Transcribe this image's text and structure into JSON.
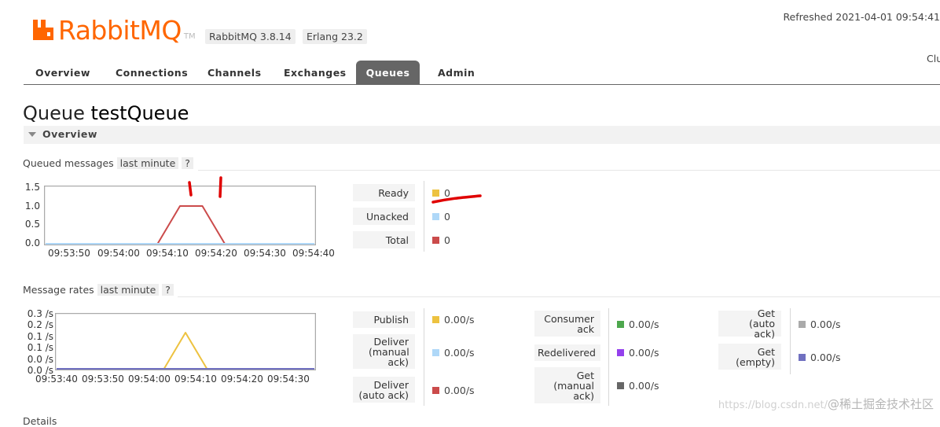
{
  "header": {
    "logo_text": "RabbitMQ",
    "logo_tm": "TM",
    "version_badge": "RabbitMQ 3.8.14",
    "erlang_badge": "Erlang 23.2",
    "refreshed": "Refreshed 2021-04-01 09:54:41",
    "cluster_partial": "Clu",
    "brand_color": "#ff6600"
  },
  "nav": {
    "tabs": [
      {
        "label": "Overview"
      },
      {
        "label": "Connections"
      },
      {
        "label": "Channels"
      },
      {
        "label": "Exchanges"
      },
      {
        "label": "Queues",
        "active": true
      },
      {
        "label": "Admin"
      }
    ]
  },
  "page": {
    "title_prefix": "Queue",
    "queue_name": "testQueue",
    "section_label": "Overview",
    "details_label": "Details"
  },
  "queued_messages": {
    "heading": "Queued messages",
    "range_chip": "last minute",
    "help_chip": "?",
    "stats": [
      {
        "label": "Ready",
        "value": "0",
        "color": "#edc240"
      },
      {
        "label": "Unacked",
        "value": "0",
        "color": "#afd8f8"
      },
      {
        "label": "Total",
        "value": "0",
        "color": "#cb4b4b"
      }
    ]
  },
  "message_rates": {
    "heading": "Message rates",
    "range_chip": "last minute",
    "help_chip": "?",
    "stats_col1": [
      {
        "label": "Publish",
        "value": "0.00/s",
        "color": "#edc240"
      },
      {
        "label": "Deliver (manual ack)",
        "value": "0.00/s",
        "color": "#afd8f8"
      },
      {
        "label": "Deliver (auto ack)",
        "value": "0.00/s",
        "color": "#cb4b4b"
      }
    ],
    "stats_col2": [
      {
        "label": "Consumer ack",
        "value": "0.00/s",
        "color": "#4da74d"
      },
      {
        "label": "Redelivered",
        "value": "0.00/s",
        "color": "#9440ed"
      },
      {
        "label": "Get (manual ack)",
        "value": "0.00/s",
        "color": "#666666"
      }
    ],
    "stats_col3": [
      {
        "label": "Get (auto ack)",
        "value": "0.00/s",
        "color": "#aaaaaa"
      },
      {
        "label": "Get (empty)",
        "value": "0.00/s",
        "color": "#7070c0"
      }
    ]
  },
  "chart_data": [
    {
      "type": "line",
      "ylim": [
        0,
        1.5
      ],
      "yticks": [
        "1.5",
        "1.0",
        "0.5",
        "0.0"
      ],
      "xlim": [
        "09:53:48",
        "09:54:48"
      ],
      "xticks": [
        "09:53:50",
        "09:54:00",
        "09:54:10",
        "09:54:20",
        "09:54:30",
        "09:54:40"
      ],
      "series": [
        {
          "color": "#cb4b4b",
          "x": [
            "09:53:48",
            "09:54:13",
            "09:54:18",
            "09:54:23",
            "09:54:28",
            "09:54:48"
          ],
          "y": [
            0,
            0,
            1,
            1,
            0,
            0
          ]
        },
        {
          "color": "#afd8f8",
          "x": [
            "09:53:48",
            "09:54:48"
          ],
          "y": [
            0,
            0
          ]
        }
      ]
    },
    {
      "type": "line",
      "ylim": [
        0,
        0.3
      ],
      "yticks": [
        "0.3 /s",
        "0.2 /s",
        "0.1 /s",
        "0.1 /s",
        "0.0 /s",
        "0.0 /s"
      ],
      "xlim": [
        "09:53:36",
        "09:54:36"
      ],
      "xticks": [
        "09:53:40",
        "09:53:50",
        "09:54:00",
        "09:54:10",
        "09:54:20",
        "09:54:30"
      ],
      "series": [
        {
          "color": "#edc240",
          "x": [
            "09:53:36",
            "09:54:01",
            "09:54:06",
            "09:54:11",
            "09:54:36"
          ],
          "y": [
            0,
            0,
            0.2,
            0,
            0
          ]
        },
        {
          "color": "#7070c0",
          "x": [
            "09:53:36",
            "09:54:36"
          ],
          "y": [
            0,
            0
          ]
        }
      ]
    }
  ],
  "watermark": {
    "text": "@稀土掘金技术社区",
    "faded_prefix": "https://blog.csdn.net/"
  }
}
